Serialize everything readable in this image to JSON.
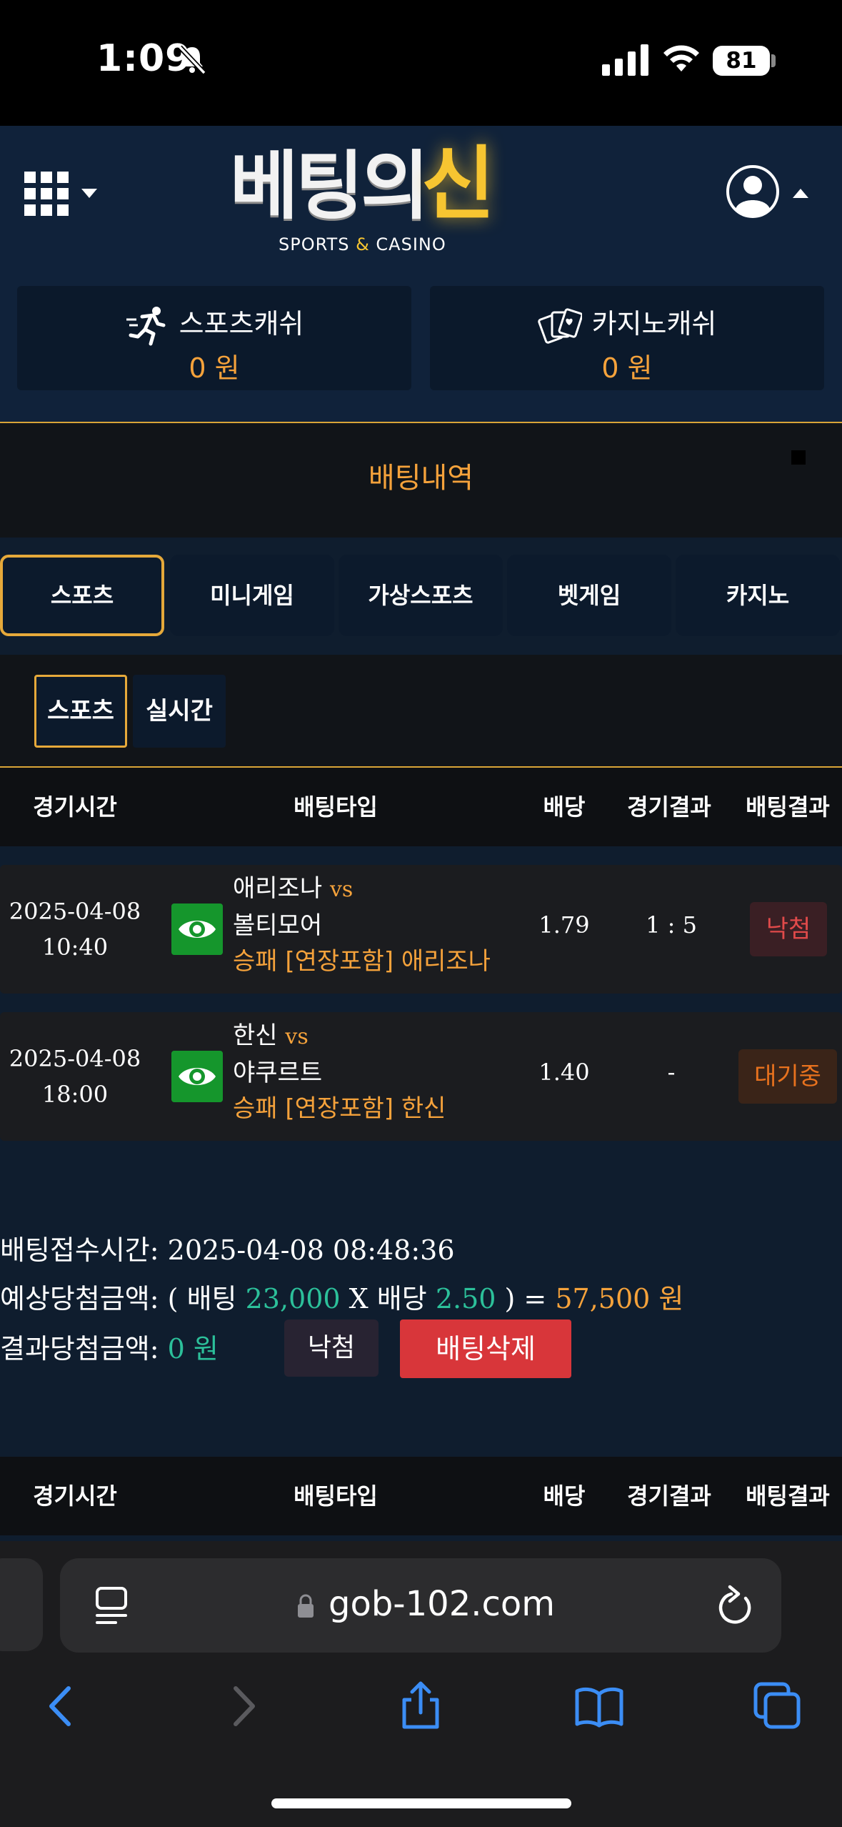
{
  "status_bar": {
    "time": "1:09",
    "battery": "81"
  },
  "header": {
    "logo_main": "베팅의",
    "logo_accent": "신",
    "logo_sub_left": "SPORTS",
    "logo_sub_amp": "&",
    "logo_sub_right": "CASINO"
  },
  "wallet": {
    "sports": {
      "label": "스포츠캐쉬",
      "amount": "0 원"
    },
    "casino": {
      "label": "카지노캐쉬",
      "amount": "0 원"
    }
  },
  "section_title": "배팅내역",
  "tabs": [
    {
      "label": "스포츠",
      "active": true
    },
    {
      "label": "미니게임"
    },
    {
      "label": "가상스포츠"
    },
    {
      "label": "벳게임"
    },
    {
      "label": "카지노"
    }
  ],
  "subtabs": [
    {
      "label": "스포츠",
      "active": true
    },
    {
      "label": "실시간"
    }
  ],
  "table_headers": [
    "경기시간",
    "배팅타입",
    "배당",
    "경기결과",
    "배팅결과"
  ],
  "bets": [
    {
      "date": "2025-04-08",
      "time": "10:40",
      "home": "애리조나",
      "vs": "vs",
      "away": "볼티모어",
      "bet_type": "승패 [연장포함] 애리조나",
      "odds": "1.79",
      "score": "1 : 5",
      "result": "낙첨"
    },
    {
      "date": "2025-04-08",
      "time": "18:00",
      "home": "한신",
      "vs": "vs",
      "away": "야쿠르트",
      "bet_type": "승패 [연장포함] 한신",
      "odds": "1.40",
      "score": "-",
      "result": "대기중"
    }
  ],
  "summary": {
    "received_label": "배팅접수시간:",
    "received_value": "2025-04-08 08:48:36",
    "expected_label": "예상당첨금액:",
    "expected_open": "( 배팅",
    "stake": "23,000",
    "x_label": "X 배당",
    "total_odds": "2.50",
    "expected_close": ") =",
    "expected_payout": "57,500 원",
    "result_label": "결과당첨금액:",
    "result_value": "0 원",
    "status_button": "낙첨",
    "delete_button": "배팅삭제"
  },
  "browser": {
    "url": "gob-102.com"
  },
  "colors": {
    "accent": "#f5a23b",
    "header_bg": "#10223a",
    "win_badge": "#e04a4a",
    "wait_badge": "#e8721e",
    "delete_button": "#d8363a",
    "eye_button": "#15962c"
  }
}
